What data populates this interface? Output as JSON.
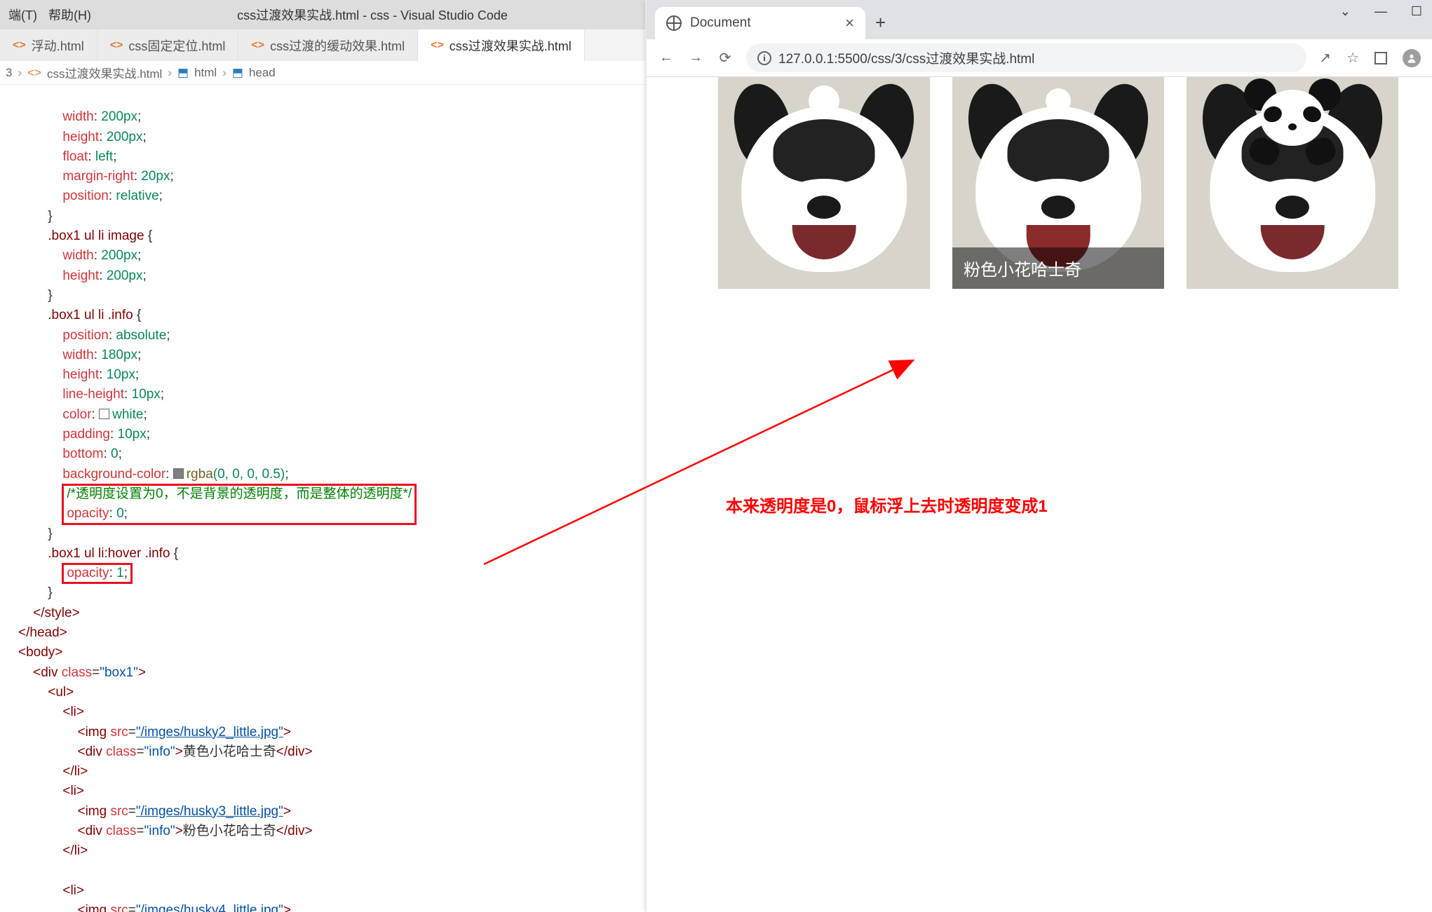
{
  "vscode": {
    "menu": {
      "item1": "端(T)",
      "item2": "帮助(H)"
    },
    "window_title": "css过渡效果实战.html - css - Visual Studio Code",
    "tabs": [
      {
        "label": "浮动.html"
      },
      {
        "label": "css固定定位.html"
      },
      {
        "label": "css过渡的缓动效果.html"
      },
      {
        "label": "css过渡效果实战.html",
        "active": true
      }
    ],
    "breadcrumb": {
      "seg1": "3",
      "seg2": "css过渡效果实战.html",
      "seg3": "html",
      "seg4": "head"
    },
    "code": {
      "l1_p": "width",
      "l1_v": "200px",
      "l2_p": "height",
      "l2_v": "200px",
      "l3_p": "float",
      "l3_v": "left",
      "l4_p": "margin-right",
      "l4_v": "20px",
      "l5_p": "position",
      "l5_v": "relative",
      "sel2": ".box1 ul li image",
      "l6_p": "width",
      "l6_v": "200px",
      "l7_p": "height",
      "l7_v": "200px",
      "sel3": ".box1 ul li .info",
      "l8_p": "position",
      "l8_v": "absolute",
      "l9_p": "width",
      "l9_v": "180px",
      "l10_p": "height",
      "l10_v": "10px",
      "l11_p": "line-height",
      "l11_v": "10px",
      "l12_p": "color",
      "l12_v": "white",
      "l13_p": "padding",
      "l13_v": "10px",
      "l14_p": "bottom",
      "l14_v": "0",
      "l15_p": "background-color",
      "l15_fn": "rgba",
      "l15_args": "(0, 0, 0, 0.5)",
      "cmt": "/*透明度设置为0，不是背景的透明度，而是整体的透明度*/",
      "l16_p": "opacity",
      "l16_v": "0",
      "sel4": ".box1 ul li:hover .info",
      "l17_p": "opacity",
      "l17_v": "1",
      "close_style": "</style>",
      "close_head": "</head>",
      "open_body": "<body>",
      "div_open_1": "<",
      "div_tag": "div",
      "div_attr": "class",
      "div_val": "\"box1\"",
      "div_close": ">",
      "ul_open": "<ul>",
      "li_open": "<li>",
      "img_tag": "img",
      "img_attr": "src",
      "img1_src": "\"/imges/husky2_little.jpg\"",
      "info_val": "\"info\"",
      "cap1": "黄色小花哈士奇",
      "li_close": "</li>",
      "img2_src": "\"/imges/husky3_little.jpg\"",
      "cap2": "粉色小花哈士奇",
      "img3_src": "\"/imges/husky4_little.jpg\""
    }
  },
  "browser": {
    "tab_title": "Document",
    "url": "127.0.0.1:5500/css/3/css过渡效果实战.html",
    "gallery": {
      "caption2": "粉色小花哈士奇"
    }
  },
  "annotation": {
    "text": "本来透明度是0，鼠标浮上去时透明度变成1"
  }
}
